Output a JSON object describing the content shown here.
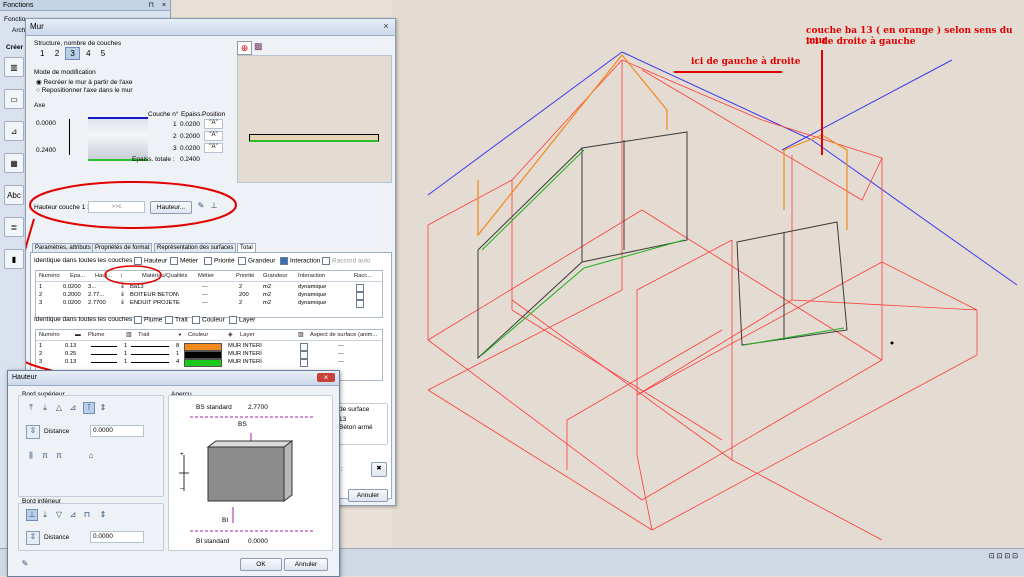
{
  "functions_panel": {
    "title": "Fonctions",
    "pin_glyph": "⊓",
    "close_glyph": "×",
    "tab_label": "Fonctio",
    "sub_label": "Arch",
    "create_label": "Créer",
    "tools": [
      "wall-icon",
      "slab-icon",
      "stair-icon",
      "grid-icon",
      "text-icon",
      "layers-icon",
      "wall-color-icon"
    ],
    "text_tool_label": "Abc"
  },
  "mur_dialog": {
    "title": "Mur",
    "close_glyph": "×",
    "structure_label": "Structure, nombre de couches",
    "layer_count_buttons": [
      "1",
      "2",
      "3",
      "4",
      "5"
    ],
    "mode_label": "Mode de modification",
    "mode_options": [
      "Recréer le mur à partir de l'axe",
      "Repositionner l'axe dans le mur"
    ],
    "axe_label": "Axe",
    "axe_top_value": "0.0000",
    "axe_bottom_value": "0.2400",
    "col_couche": "Couche n°",
    "col_epaiss": "Epaiss.",
    "col_position": "Position",
    "layers": [
      {
        "n": "1",
        "epaiss": "0.0200",
        "pos": "\"A\""
      },
      {
        "n": "2",
        "epaiss": "0.2000",
        "pos": "\"A\""
      },
      {
        "n": "3",
        "epaiss": "0.0200",
        "pos": "\"A\""
      }
    ],
    "total_label": "Epaiss. totale :",
    "total_value": "0.2400",
    "hauteur_couche_label": "Hauteur couche 1 :",
    "hauteur_couche_value": ">>c",
    "hauteur_button": "Hauteur...",
    "tabs": [
      "Paramètres, attributs",
      "Propriétés de format",
      "Représentation des surfaces",
      "Total"
    ],
    "identique_label": "Identique dans toutes les couches :",
    "identique_options": [
      {
        "label": "Hauteur",
        "checked": false
      },
      {
        "label": "Métier",
        "checked": false
      },
      {
        "label": "Priorité",
        "checked": false
      },
      {
        "label": "Grandeur",
        "checked": false
      },
      {
        "label": "Interaction",
        "checked": true
      },
      {
        "label": "Raccord auto",
        "checked": false
      }
    ],
    "table1_headers": [
      "Numéro",
      "Epa...",
      "Haut...",
      "",
      "Matériau/Qualités",
      "Métier",
      "Priorité",
      "Grandeur",
      "Interaction",
      "Racc..."
    ],
    "table1_rows": [
      {
        "num": "1",
        "epa": "0.0200",
        "haut": "3...",
        "mat": "Ba13",
        "metier": "---",
        "prio": "2",
        "grandeur": "m2",
        "inter": "dynamique"
      },
      {
        "num": "2",
        "epa": "0.2000",
        "haut": "2.77...",
        "mat": "BOITEUR BETON\\",
        "metier": "---",
        "prio": "200",
        "grandeur": "m2",
        "inter": "dynamique"
      },
      {
        "num": "3",
        "epa": "0.0200",
        "haut": "2.7700",
        "mat": "ENDUIT PROJETE",
        "metier": "---",
        "prio": "2",
        "grandeur": "m2",
        "inter": "dynamique"
      }
    ],
    "identique2_label": "Identique dans toutes les couches :",
    "identique2_options": [
      {
        "label": "Plume",
        "checked": false
      },
      {
        "label": "Trait",
        "checked": false
      },
      {
        "label": "Couleur",
        "checked": false
      },
      {
        "label": "Layer",
        "checked": false
      }
    ],
    "table2_headers": [
      "Numéro",
      "Plume",
      "Trait",
      "Couleur",
      "Layer",
      "Aspect de surface (anim..."
    ],
    "table2_rows": [
      {
        "num": "1",
        "plume": "0.13",
        "trait": "1",
        "couleur": "8",
        "swatch": "#f08a1c",
        "layer": "MUR INTERI",
        "aspect": "---"
      },
      {
        "num": "2",
        "plume": "0.25",
        "trait": "1",
        "couleur": "1",
        "swatch": "#000000",
        "layer": "MUR INTERI",
        "aspect": "---"
      },
      {
        "num": "3",
        "plume": "0.13",
        "trait": "1",
        "couleur": "4",
        "swatch": "#19c819",
        "layer": "MUR INTERI",
        "aspect": "---"
      }
    ],
    "right_partial_header": "de surface",
    "right_partial_lines": [
      "13",
      "Béton armé"
    ],
    "right_partial_x": "x :",
    "annuler_button": "Annuler"
  },
  "hauteur_dialog": {
    "title": "Hauteur",
    "close_glyph": "×",
    "bord_sup_label": "Bord supérieur",
    "bord_inf_label": "Bord inférieur",
    "distance_label": "Distance",
    "distance_top": "0.0000",
    "distance_bottom": "0.0000",
    "apercu_label": "Aperçu",
    "bs_standard_label": "BS standard",
    "bs_standard_value": "2.7700",
    "bs_tag": "BS",
    "bi_tag": "BI",
    "bi_standard_label": "BI standard",
    "bi_standard_value": "0.0000",
    "plus": "+",
    "minus": "–",
    "ok_button": "OK",
    "cancel_button": "Annuler"
  },
  "annotations": {
    "left_note": "ici de gauche à droite",
    "right_note_line1": "couche ba 13 ( en orange ) selon sens du mur",
    "right_note_line2": "ici de droite à gauche"
  },
  "statusbar": {
    "right_items": [
      "⊡ ⊡ ⊡ ⊡"
    ]
  },
  "colors": {
    "annotation_red": "#e00000",
    "orange_layer": "#f08a1c",
    "green_layer": "#19c819",
    "wire_red": "#ff3030",
    "roof_blue": "#2a2af0"
  }
}
